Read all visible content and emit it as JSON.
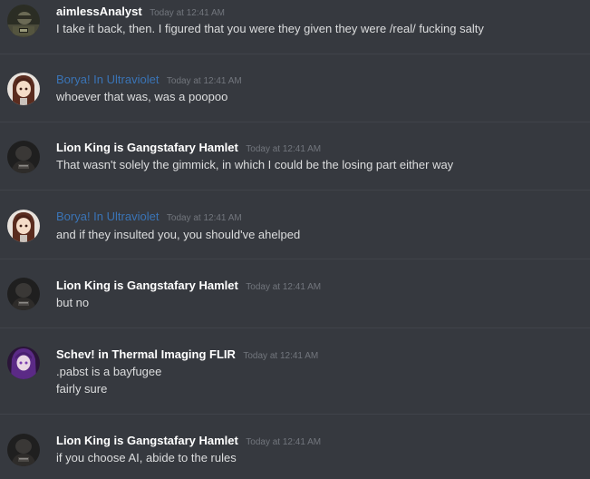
{
  "channel": {
    "messages": [
      {
        "author": "aimlessAnalyst",
        "author_color": "#ffffff",
        "avatar": "soldier-avatar",
        "timestamp": "Today at 12:41 AM",
        "lines": [
          "I take it back, then. I figured that you were they given they were /real/ fucking salty"
        ]
      },
      {
        "author": "Borya! In Ultraviolet",
        "author_color": "#3a74b6",
        "avatar": "anime-girl-avatar",
        "timestamp": "Today at 12:41 AM",
        "lines": [
          "whoever that was, was a poopoo"
        ]
      },
      {
        "author": "Lion King is Gangstafary Hamlet",
        "author_color": "#ffffff",
        "avatar": "dark-figure-avatar",
        "timestamp": "Today at 12:41 AM",
        "lines": [
          "That wasn't solely the gimmick, in which I could be the losing part either way"
        ]
      },
      {
        "author": "Borya! In Ultraviolet",
        "author_color": "#3a74b6",
        "avatar": "anime-girl-avatar",
        "timestamp": "Today at 12:41 AM",
        "lines": [
          "and if they insulted you, you should've ahelped"
        ]
      },
      {
        "author": "Lion King is Gangstafary Hamlet",
        "author_color": "#ffffff",
        "avatar": "dark-figure-avatar",
        "timestamp": "Today at 12:41 AM",
        "lines": [
          "but no"
        ]
      },
      {
        "author": "Schev! in Thermal Imaging FLIR",
        "author_color": "#ffffff",
        "avatar": "purple-hair-avatar",
        "timestamp": "Today at 12:41 AM",
        "lines": [
          ".pabst is a bayfugee",
          "fairly sure"
        ]
      },
      {
        "author": "Lion King is Gangstafary Hamlet",
        "author_color": "#ffffff",
        "avatar": "dark-figure-avatar",
        "timestamp": "Today at 12:41 AM",
        "lines": [
          "if you choose AI, abide to the rules"
        ]
      }
    ]
  },
  "colors": {
    "background": "#36393f",
    "divider": "#40434a",
    "text": "#dcddde",
    "timestamp": "#72767d",
    "author_default": "#ffffff",
    "author_blue": "#3a74b6"
  }
}
